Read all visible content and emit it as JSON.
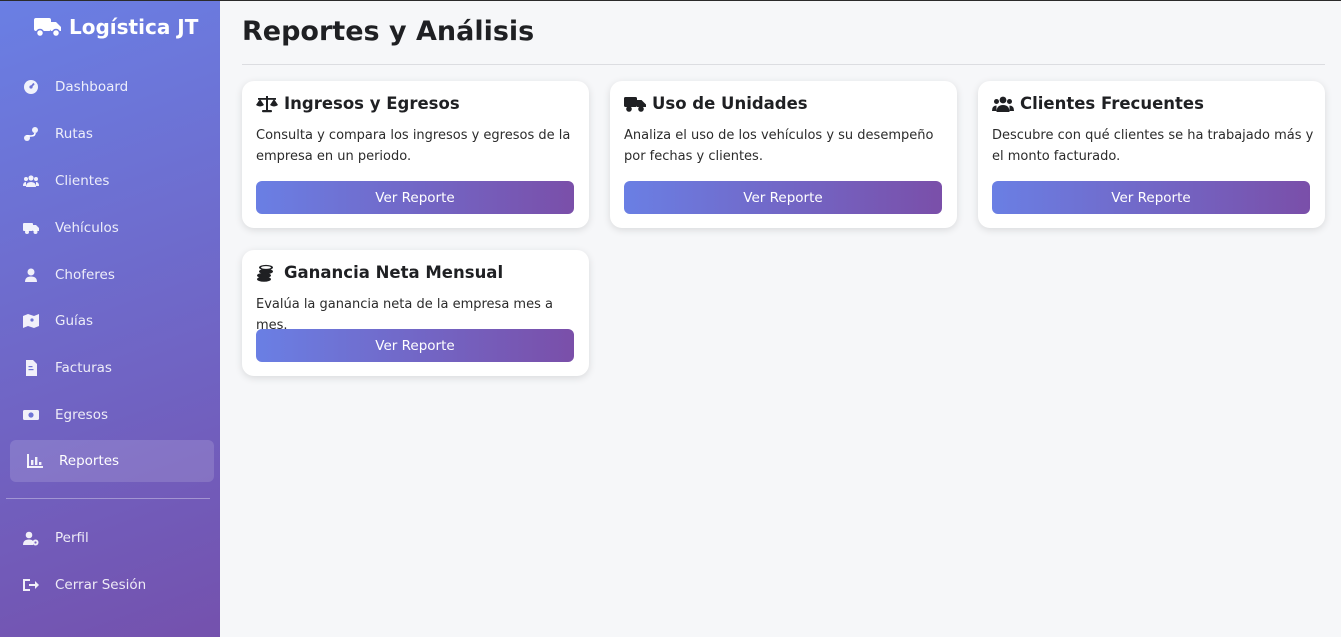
{
  "app": {
    "brand": "Logística JT",
    "brand_icon": "truck-icon"
  },
  "sidebar": {
    "items": [
      {
        "label": "Dashboard",
        "icon": "gauge-icon"
      },
      {
        "label": "Rutas",
        "icon": "route-icon"
      },
      {
        "label": "Clientes",
        "icon": "users-icon"
      },
      {
        "label": "Vehículos",
        "icon": "truck-icon"
      },
      {
        "label": "Choferes",
        "icon": "user-icon"
      },
      {
        "label": "Guías",
        "icon": "map-icon"
      },
      {
        "label": "Facturas",
        "icon": "file-invoice-icon"
      },
      {
        "label": "Egresos",
        "icon": "money-icon"
      },
      {
        "label": "Reportes",
        "icon": "chart-icon",
        "active": true
      }
    ],
    "bottom_items": [
      {
        "label": "Perfil",
        "icon": "user-gear-icon"
      },
      {
        "label": "Cerrar Sesión",
        "icon": "logout-icon"
      }
    ]
  },
  "page": {
    "title": "Reportes y Análisis"
  },
  "cards": [
    {
      "title": "Ingresos y Egresos",
      "icon": "scale-icon",
      "description": "Consulta y compara los ingresos y egresos de la empresa en un periodo.",
      "button": "Ver Reporte"
    },
    {
      "title": "Uso de Unidades",
      "icon": "truck-icon",
      "description": "Analiza el uso de los vehículos y su desempeño por fechas y clientes.",
      "button": "Ver Reporte"
    },
    {
      "title": "Clientes Frecuentes",
      "icon": "users-icon",
      "description": "Descubre con qué clientes se ha trabajado más y el monto facturado.",
      "button": "Ver Reporte"
    },
    {
      "title": "Ganancia Neta Mensual",
      "icon": "coins-icon",
      "description": "Evalúa la ganancia neta de la empresa mes a mes.",
      "button": "Ver Reporte"
    }
  ],
  "colors": {
    "sidebar_start": "#6a7fe4",
    "sidebar_end": "#7451ad",
    "background": "#f6f7f9"
  }
}
